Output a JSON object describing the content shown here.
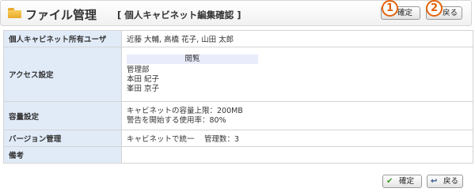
{
  "header": {
    "title": "ファイル管理",
    "subtitle": "[ 個人キャビネット編集確認 ]",
    "badge1": "1",
    "badge2": "2"
  },
  "buttons": {
    "confirm": "確定",
    "back": "戻る"
  },
  "rows": {
    "owner": {
      "label": "個人キャビネット所有ユーザ",
      "value": "近藤 大輔, 高橋 花子, 山田 太郎"
    },
    "access": {
      "label": "アクセス設定",
      "perm_header": "閲覧",
      "entries": [
        "管理部",
        "本田 紀子",
        "峯田 京子"
      ]
    },
    "capacity": {
      "label": "容量設定",
      "line1": "キャビネットの容量上限：200MB",
      "line2": "警告を開始する使用率：80%"
    },
    "version": {
      "label": "バージョン管理",
      "value": "キャビネットで統一　 管理数：3"
    },
    "note": {
      "label": "備考",
      "value": ""
    }
  },
  "colors": {
    "label_bg": "#e1ebf8",
    "badge": "#e2620b",
    "check": "#3b9a1f"
  },
  "icons": {
    "header": "folder-icon",
    "confirm": "check-icon",
    "back": "back-arrow-icon"
  }
}
